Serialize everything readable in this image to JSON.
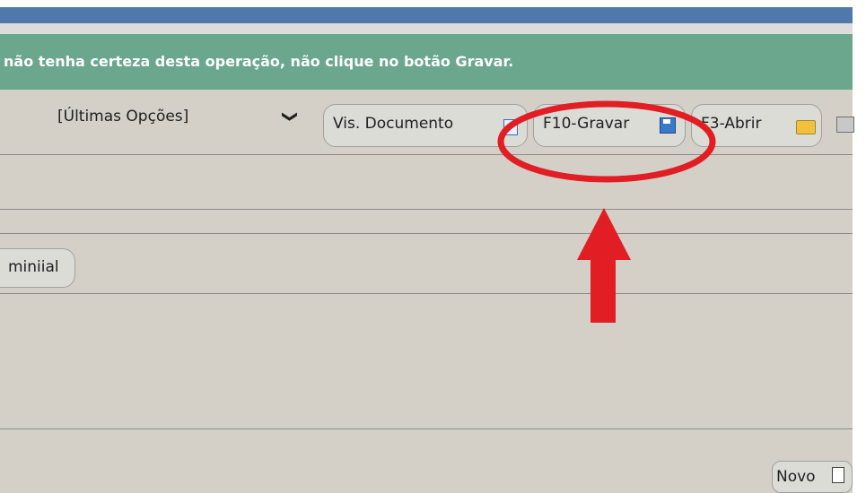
{
  "window": {
    "title": ""
  },
  "warning": {
    "text": "não tenha certeza desta operação, não clique no botão Gravar."
  },
  "toolbar": {
    "options_select": {
      "selected": "[Últimas Opções]",
      "chevron": "❯"
    },
    "buttons": [
      {
        "label": "Vis. Documento",
        "icon": "document-icon"
      },
      {
        "label": "F10-Gravar",
        "icon": "floppy-disk-icon"
      },
      {
        "label": "F3-Abrir",
        "icon": "open-folder-icon"
      },
      {
        "label": "",
        "icon": "printer-icon"
      }
    ]
  },
  "form": {
    "condominial_button": {
      "label": "miniial"
    },
    "novo_button": {
      "label": "Novo",
      "icon": "new-document-icon"
    }
  },
  "annotations": {
    "highlight_color": "#e01e24",
    "circle_target": "F10-Gravar",
    "arrow_direction": "up"
  },
  "colors": {
    "title_bar": "#4f79ac",
    "warning_bar": "#6aa78c",
    "background": "#d4d0c8"
  }
}
